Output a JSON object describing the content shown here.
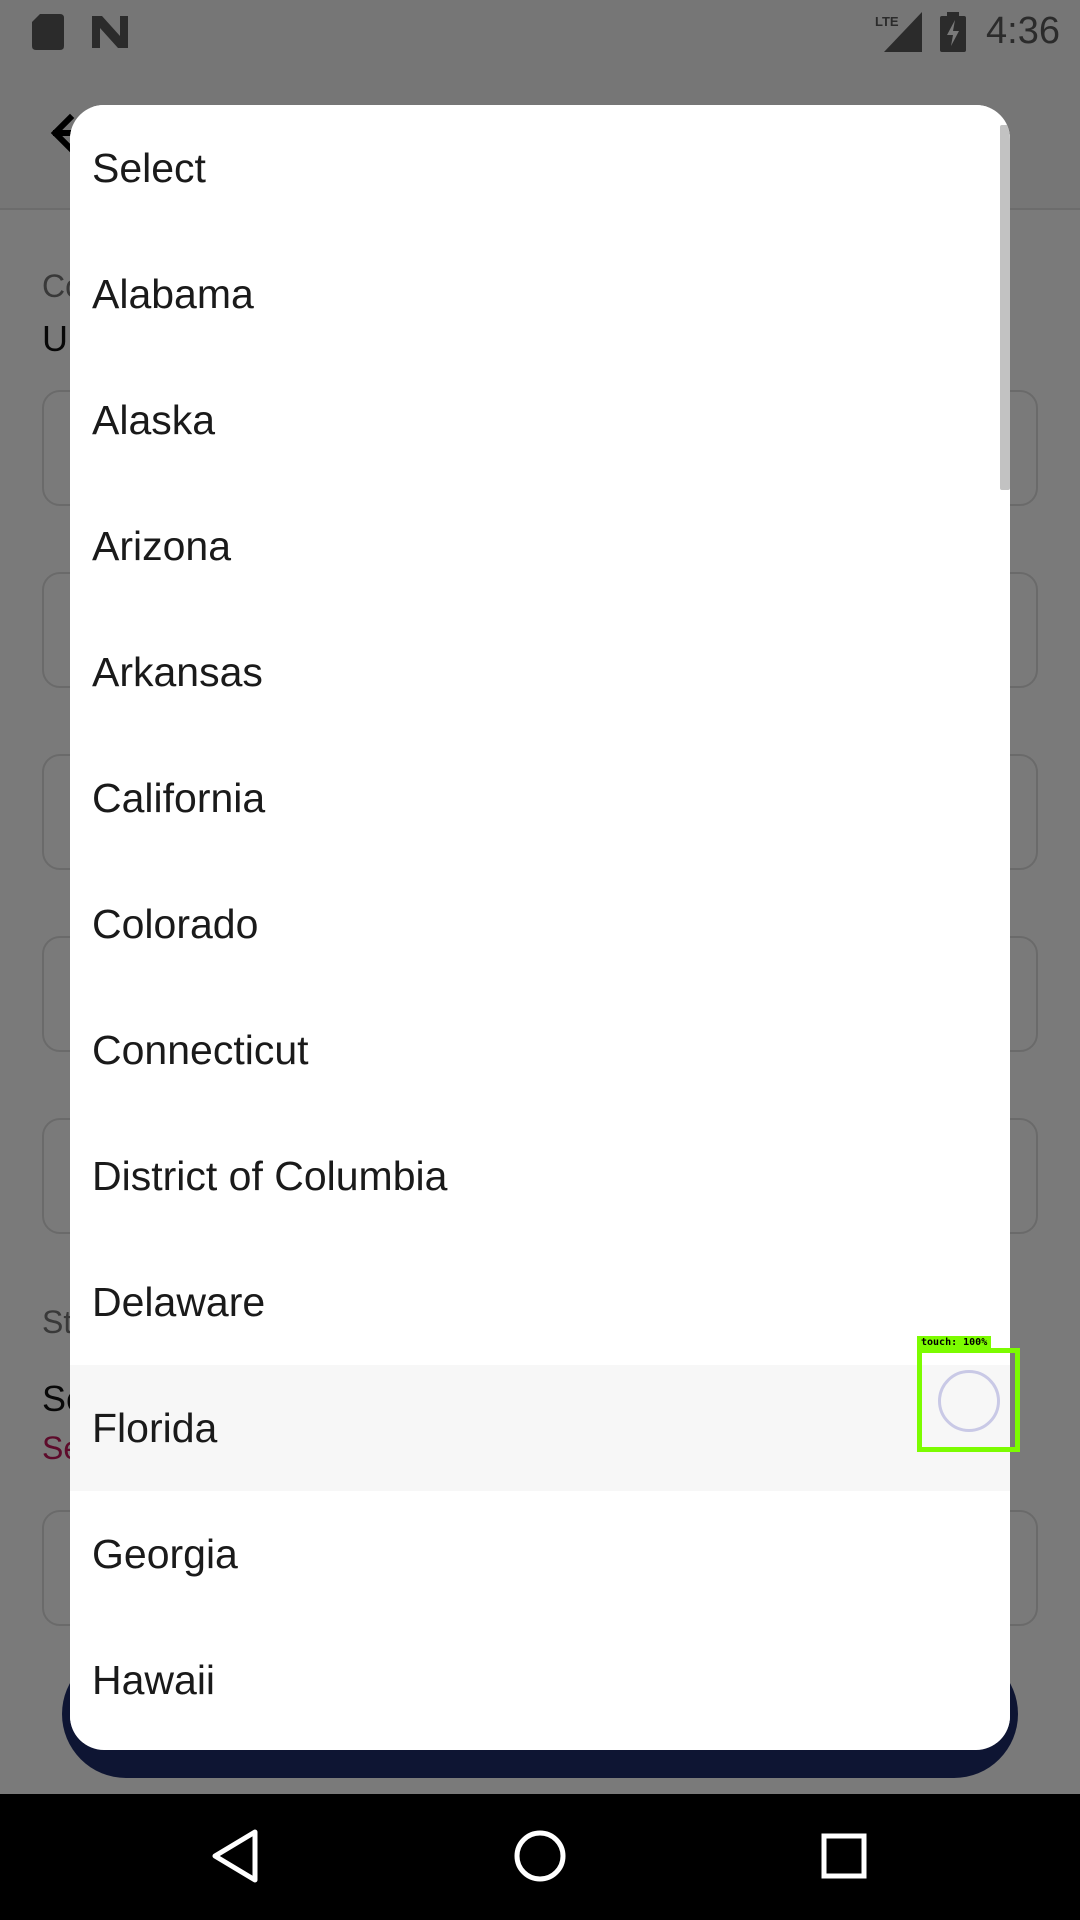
{
  "status_bar": {
    "time": "4:36",
    "network": "LTE",
    "icons": [
      "sd-card-icon",
      "n-notification-icon",
      "lte-signal-icon",
      "battery-charging-icon"
    ]
  },
  "background_page": {
    "partial_texts": {
      "country_label": "Co",
      "country_value": "Ur",
      "state_label": "St",
      "state_value": "Se",
      "state_error": "Se"
    }
  },
  "dialog": {
    "options": [
      {
        "label": "Select"
      },
      {
        "label": "Alabama"
      },
      {
        "label": "Alaska"
      },
      {
        "label": "Arizona"
      },
      {
        "label": "Arkansas"
      },
      {
        "label": "California"
      },
      {
        "label": "Colorado"
      },
      {
        "label": "Connecticut"
      },
      {
        "label": "District of Columbia"
      },
      {
        "label": "Delaware"
      },
      {
        "label": "Florida"
      },
      {
        "label": "Georgia"
      },
      {
        "label": "Hawaii"
      }
    ],
    "pressed_option": "Florida"
  },
  "touch_indicator": {
    "label": "touch: 100%"
  },
  "colors": {
    "scrim": "#000000",
    "accent_button": "#1f2d6b",
    "error_text": "#c2185b",
    "touch_overlay": "#7cfc00"
  }
}
